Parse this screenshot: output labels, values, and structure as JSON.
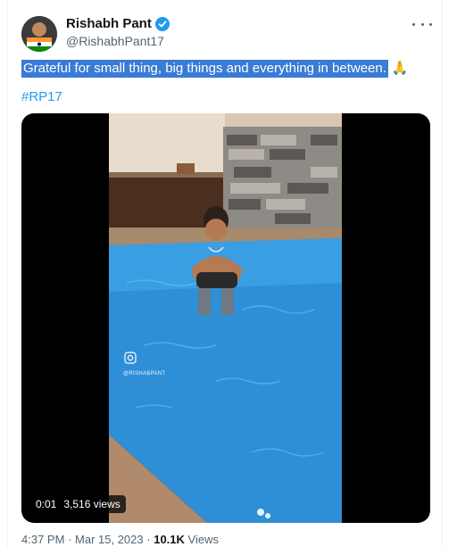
{
  "author": {
    "name": "Rishabh Pant",
    "handle": "@RishabhPant17"
  },
  "tweet": {
    "text": "Grateful for small thing, big things and everything in between.",
    "emoji": "🙏",
    "hashtag": "#RP17"
  },
  "video": {
    "elapsed": "0:01",
    "views": "3,516 views",
    "watermark": "@RISHABPANT"
  },
  "meta": {
    "time": "4:37 PM",
    "separator1": "·",
    "date": "Mar 15, 2023",
    "separator2": "·",
    "view_count": "10.1K",
    "views_label": "Views"
  },
  "colors": {
    "accent": "#1d9bf0",
    "selection": "#3a7bd5",
    "pool_water": "#2f8fd6"
  }
}
